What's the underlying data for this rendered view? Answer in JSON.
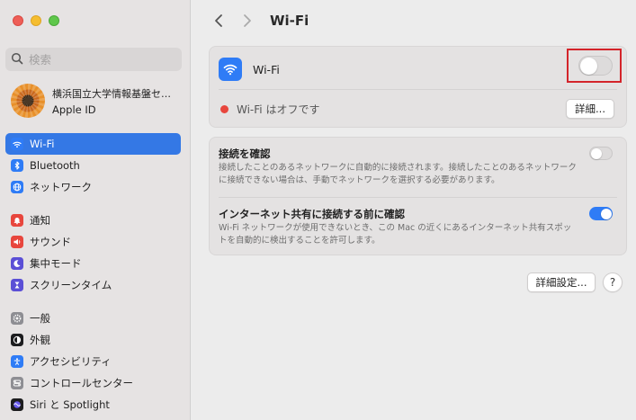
{
  "search": {
    "placeholder": "検索"
  },
  "account": {
    "name": "横浜国立大学情報基盤セン…",
    "sub": "Apple ID"
  },
  "sidebar": {
    "group1": [
      {
        "label": "Wi-Fi",
        "icon": "wifi-icon",
        "color": "#2f7cf6"
      },
      {
        "label": "Bluetooth",
        "icon": "bluetooth-icon",
        "color": "#2f7cf6"
      },
      {
        "label": "ネットワーク",
        "icon": "globe-icon",
        "color": "#2f7cf6"
      }
    ],
    "group2": [
      {
        "label": "通知",
        "icon": "bell-icon",
        "color": "#e8463d"
      },
      {
        "label": "サウンド",
        "icon": "speaker-icon",
        "color": "#e8463d"
      },
      {
        "label": "集中モード",
        "icon": "moon-icon",
        "color": "#5b4fd6"
      },
      {
        "label": "スクリーンタイム",
        "icon": "hourglass-icon",
        "color": "#5b4fd6"
      }
    ],
    "group3": [
      {
        "label": "一般",
        "icon": "gear-icon",
        "color": "#8e8e93"
      },
      {
        "label": "外観",
        "icon": "appearance-icon",
        "color": "#1d1d1f"
      },
      {
        "label": "アクセシビリティ",
        "icon": "accessibility-icon",
        "color": "#2f7cf6"
      },
      {
        "label": "コントロールセンター",
        "icon": "control-center-icon",
        "color": "#8e8e93"
      },
      {
        "label": "Siri と Spotlight",
        "icon": "siri-icon",
        "color": "#1d1d1f"
      }
    ]
  },
  "header": {
    "title": "Wi-Fi"
  },
  "wifi": {
    "label": "Wi-Fi",
    "enabled": false,
    "status": "Wi-Fi はオフです",
    "details_button": "詳細..."
  },
  "options": {
    "ask_join": {
      "title": "接続を確認",
      "desc": "接続したことのあるネットワークに自動的に接続されます。接続したことのあるネットワークに接続できない場合は、手動でネットワークを選択する必要があります。",
      "enabled": false
    },
    "ask_hotspot": {
      "title": "インターネット共有に接続する前に確認",
      "desc": "Wi-Fi ネットワークが使用できないとき、この Mac の近くにあるインターネット共有スポットを自動的に検出することを許可します。",
      "enabled": true
    }
  },
  "footer": {
    "advanced_button": "詳細設定...",
    "help_button": "?"
  },
  "colors": {
    "accent": "#2f7cf6",
    "highlight": "#d4242a",
    "status_off": "#e8463d"
  }
}
